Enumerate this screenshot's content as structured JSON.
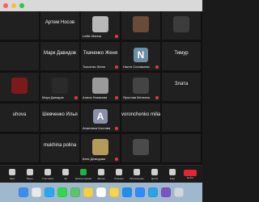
{
  "window": {
    "controls": [
      "close",
      "minimize",
      "zoom"
    ]
  },
  "participants": {
    "rows": [
      [
        {
          "name": "",
          "type": "blank"
        },
        {
          "name": "",
          "label": "Артем Носов",
          "type": "blank"
        },
        {
          "name": "Lettle Marina",
          "type": "video",
          "color": "#b9b9b9"
        },
        {
          "name": "",
          "type": "video",
          "color": "#6b4a3a"
        },
        {
          "name": "",
          "type": "video",
          "color": "#3c3c3c"
        }
      ],
      [
        {
          "name": "",
          "type": "blank"
        },
        {
          "name": "",
          "label": "Марк Давидов",
          "type": "blank"
        },
        {
          "name": "Ткаченко Женя",
          "label": "Ткаченко Женя",
          "type": "blank"
        },
        {
          "name": "Настя Соловьева",
          "type": "avatar",
          "letter": "N",
          "color": "#6d8fa3"
        },
        {
          "name": "",
          "label": "Тимур",
          "type": "blank"
        }
      ],
      [
        {
          "name": "",
          "type": "video",
          "color": "#7a1a1a"
        },
        {
          "name": "Марк Давидов",
          "type": "video",
          "color": "#2a2a2a"
        },
        {
          "name": "Алиса Новикова",
          "type": "video",
          "color": "#9a9a9a"
        },
        {
          "name": "Ярослав Мельник",
          "type": "video",
          "color": "#444"
        },
        {
          "name": "",
          "label": "Злата",
          "type": "blank"
        }
      ],
      [
        {
          "name": "",
          "label": "uhova",
          "type": "blank"
        },
        {
          "name": "",
          "label": "Шевченко Илья",
          "type": "blank"
        },
        {
          "name": "Анжелика Костова",
          "type": "avatar",
          "letter": "A",
          "color": "#8b8fa8"
        },
        {
          "name": "",
          "label": "voronchenko miliana",
          "type": "blank"
        },
        {
          "name": "",
          "type": "blank"
        }
      ],
      [
        {
          "name": "",
          "type": "blank"
        },
        {
          "name": "",
          "label": "mukhina polina",
          "type": "blank"
        },
        {
          "name": "Катя Демидова",
          "type": "video",
          "color": "#b59a5a"
        },
        {
          "name": "",
          "type": "video",
          "color": "#4a4a4a"
        },
        {
          "name": "",
          "type": "blank"
        }
      ]
    ]
  },
  "toolbar": {
    "items": [
      {
        "label": "Звук",
        "icon": "mic-icon"
      },
      {
        "label": "Видео",
        "icon": "video-icon"
      },
      {
        "label": "Участники",
        "icon": "participants-icon"
      },
      {
        "label": "Чат",
        "icon": "chat-icon"
      },
      {
        "label": "Демонстрация",
        "icon": "share-icon",
        "accent": true
      },
      {
        "label": "Запись",
        "icon": "record-icon"
      },
      {
        "label": "Реакции",
        "icon": "reactions-icon"
      },
      {
        "label": "Приложения",
        "icon": "apps-icon"
      },
      {
        "label": "Доска",
        "icon": "whiteboard-icon"
      },
      {
        "label": "Ещё",
        "icon": "more-icon"
      }
    ],
    "end_label": "Выйти"
  },
  "dock": {
    "icons": [
      {
        "name": "finder-icon",
        "color": "#3b8ef0"
      },
      {
        "name": "launchpad-icon",
        "color": "#e9e9e9"
      },
      {
        "name": "safari-icon",
        "color": "#2aa7f0"
      },
      {
        "name": "messages-icon",
        "color": "#32d74b"
      },
      {
        "name": "maps-icon",
        "color": "#5cc36a"
      },
      {
        "name": "photos-icon",
        "color": "#f5d142"
      },
      {
        "name": "calendar-icon",
        "color": "#ffffff"
      },
      {
        "name": "notes-icon",
        "color": "#f7d54a"
      },
      {
        "name": "appstore-icon",
        "color": "#1f8ef1"
      },
      {
        "name": "zoom-icon",
        "color": "#2d8cff"
      },
      {
        "name": "telegram-icon",
        "color": "#2aa3e6"
      },
      {
        "name": "viber-icon",
        "color": "#7c53c3"
      },
      {
        "name": "trash-icon",
        "color": "#cfd6dc"
      }
    ]
  }
}
